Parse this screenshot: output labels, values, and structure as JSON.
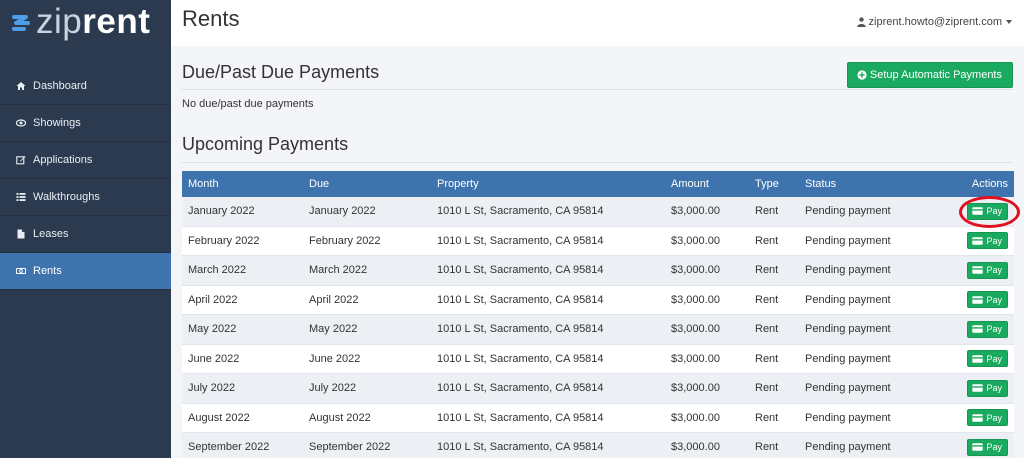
{
  "brand": {
    "name_part1": "zip",
    "name_part2": "rent"
  },
  "sidebar": {
    "items": [
      {
        "label": "Dashboard",
        "icon": "home-icon",
        "active": false
      },
      {
        "label": "Showings",
        "icon": "eye-icon",
        "active": false
      },
      {
        "label": "Applications",
        "icon": "edit-icon",
        "active": false
      },
      {
        "label": "Walkthroughs",
        "icon": "list-icon",
        "active": false
      },
      {
        "label": "Leases",
        "icon": "file-icon",
        "active": false
      },
      {
        "label": "Rents",
        "icon": "money-icon",
        "active": true
      }
    ]
  },
  "header": {
    "title": "Rents",
    "user_email": "ziprent.howto@ziprent.com"
  },
  "due_section": {
    "title": "Due/Past Due Payments",
    "empty_message": "No due/past due payments",
    "setup_button": "Setup Automatic Payments"
  },
  "upcoming_section": {
    "title": "Upcoming Payments",
    "columns": {
      "month": "Month",
      "due": "Due",
      "property": "Property",
      "amount": "Amount",
      "type": "Type",
      "status": "Status",
      "actions": "Actions"
    },
    "pay_label": "Pay",
    "rows": [
      {
        "month": "January 2022",
        "due": "January 2022",
        "property": "1010 L St, Sacramento, CA 95814",
        "amount": "$3,000.00",
        "type": "Rent",
        "status": "Pending payment"
      },
      {
        "month": "February 2022",
        "due": "February 2022",
        "property": "1010 L St, Sacramento, CA 95814",
        "amount": "$3,000.00",
        "type": "Rent",
        "status": "Pending payment"
      },
      {
        "month": "March 2022",
        "due": "March 2022",
        "property": "1010 L St, Sacramento, CA 95814",
        "amount": "$3,000.00",
        "type": "Rent",
        "status": "Pending payment"
      },
      {
        "month": "April 2022",
        "due": "April 2022",
        "property": "1010 L St, Sacramento, CA 95814",
        "amount": "$3,000.00",
        "type": "Rent",
        "status": "Pending payment"
      },
      {
        "month": "May 2022",
        "due": "May 2022",
        "property": "1010 L St, Sacramento, CA 95814",
        "amount": "$3,000.00",
        "type": "Rent",
        "status": "Pending payment"
      },
      {
        "month": "June 2022",
        "due": "June 2022",
        "property": "1010 L St, Sacramento, CA 95814",
        "amount": "$3,000.00",
        "type": "Rent",
        "status": "Pending payment"
      },
      {
        "month": "July 2022",
        "due": "July 2022",
        "property": "1010 L St, Sacramento, CA 95814",
        "amount": "$3,000.00",
        "type": "Rent",
        "status": "Pending payment"
      },
      {
        "month": "August 2022",
        "due": "August 2022",
        "property": "1010 L St, Sacramento, CA 95814",
        "amount": "$3,000.00",
        "type": "Rent",
        "status": "Pending payment"
      },
      {
        "month": "September 2022",
        "due": "September 2022",
        "property": "1010 L St, Sacramento, CA 95814",
        "amount": "$3,000.00",
        "type": "Rent",
        "status": "Pending payment"
      }
    ]
  },
  "colors": {
    "sidebar_bg": "#2b3a4e",
    "accent_blue": "#3e73ad",
    "success_green": "#1aaa5f",
    "highlight_red": "#e0101e"
  }
}
